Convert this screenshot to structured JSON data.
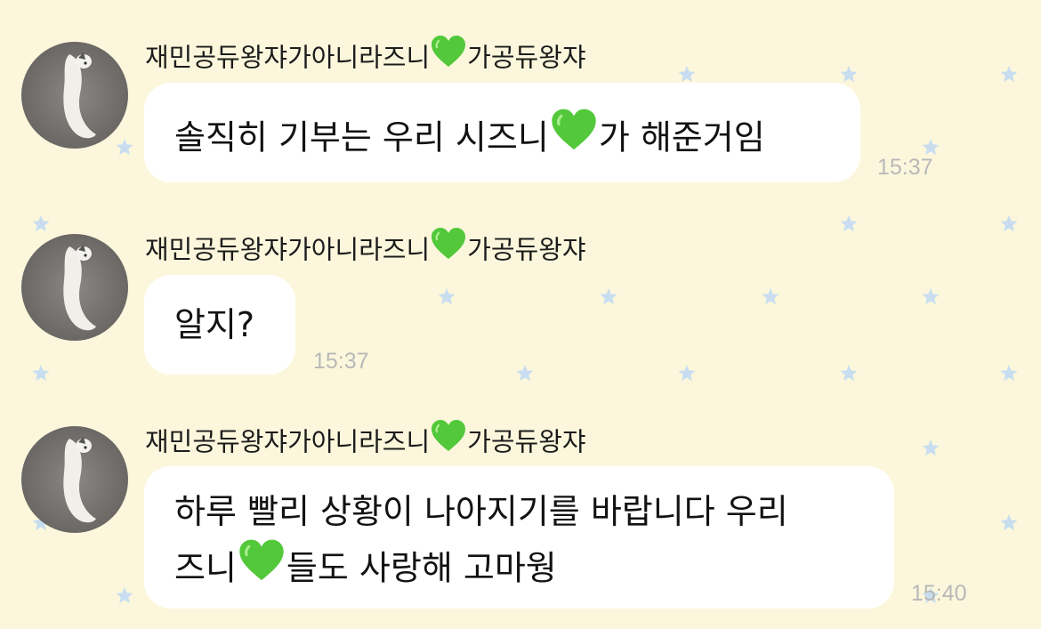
{
  "colors": {
    "background": "#fcf7dc",
    "star": "#c8def0",
    "bubble": "#ffffff",
    "heart": "#52c83a",
    "timestamp": "#b8b8b8"
  },
  "messages": [
    {
      "sender_prefix": "재민공듀왕쟈가아니라즈니",
      "sender_suffix": "가공듀왕쟈",
      "lines": [
        {
          "before": "솔직히 기부는 우리 시즈니",
          "after": "가 해준거임"
        }
      ],
      "time": "15:37",
      "avatar_icon": "cat-photo"
    },
    {
      "sender_prefix": "재민공듀왕쟈가아니라즈니",
      "sender_suffix": "가공듀왕쟈",
      "lines": [
        {
          "before": "알지?",
          "after": ""
        }
      ],
      "time": "15:37",
      "avatar_icon": "cat-photo"
    },
    {
      "sender_prefix": "재민공듀왕쟈가아니라즈니",
      "sender_suffix": "가공듀왕쟈",
      "lines": [
        {
          "before": "하루 빨리 상황이 나아지기를 바랍니다 우리",
          "after": ""
        },
        {
          "before": "즈니",
          "after": "들도 사랑해 고마웡"
        }
      ],
      "time": "15:40",
      "avatar_icon": "cat-photo"
    }
  ],
  "icons": {
    "heart": "green-heart-icon",
    "background_pattern": "star-icon"
  }
}
